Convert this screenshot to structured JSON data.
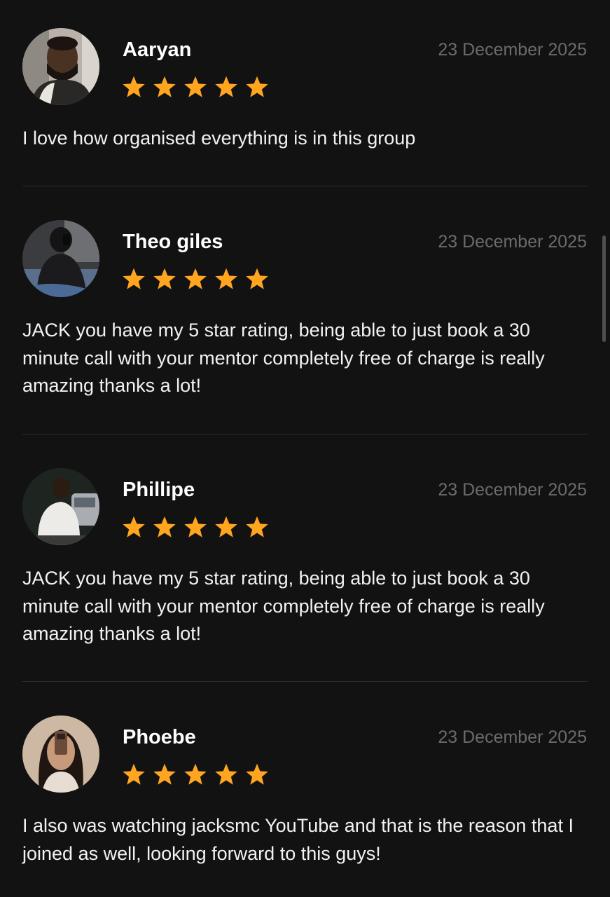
{
  "reviews": [
    {
      "name": "Aaryan",
      "date": "23 December 2025",
      "rating": 5,
      "text": "I love how organised everything is in this group"
    },
    {
      "name": "Theo giles",
      "date": "23 December 2025",
      "rating": 5,
      "text": "JACK you have my 5 star rating, being able to just book a 30 minute call with your mentor completely free of charge is really amazing thanks a lot!"
    },
    {
      "name": "Phillipe",
      "date": "23 December 2025",
      "rating": 5,
      "text": "JACK you have my 5 star rating, being able to just book a 30 minute call with your mentor completely free of charge is really amazing thanks a lot!"
    },
    {
      "name": "Phoebe",
      "date": "23 December 2025",
      "rating": 5,
      "text": "I also was watching jacksmc YouTube and that is the reason that I joined as well, looking forward to this guys!"
    }
  ],
  "icons": {
    "star": "star-icon",
    "avatar": "avatar"
  },
  "colors": {
    "background": "#121212",
    "star": "#FFA51F",
    "name": "#FFFFFF",
    "date": "#6B6B6B",
    "body_text": "#F2F2F2",
    "divider": "#2C2C2C"
  }
}
